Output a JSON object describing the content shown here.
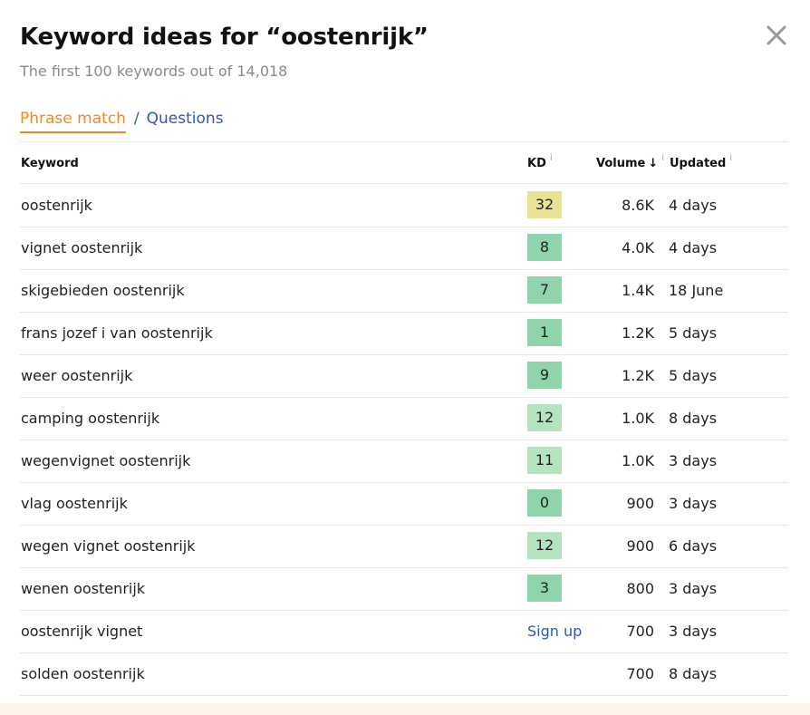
{
  "header": {
    "title": "Keyword ideas for “oostenrijk”",
    "subtitle": "The first 100 keywords out of 14,018"
  },
  "tabs": {
    "active": "Phrase match",
    "separator": "/",
    "other": "Questions"
  },
  "columns": {
    "keyword": "Keyword",
    "kd": "KD",
    "volume": "Volume",
    "updated": "Updated",
    "info_glyph": "i",
    "sort_arrow": "↓"
  },
  "rows": [
    {
      "keyword": "oostenrijk",
      "kd": "32",
      "kd_color": "#e8e391",
      "volume": "8.6K",
      "updated": "4 days"
    },
    {
      "keyword": "vignet oostenrijk",
      "kd": "8",
      "kd_color": "#8fd4ab",
      "volume": "4.0K",
      "updated": "4 days"
    },
    {
      "keyword": "skigebieden oostenrijk",
      "kd": "7",
      "kd_color": "#8fd4ab",
      "volume": "1.4K",
      "updated": "18 June"
    },
    {
      "keyword": "frans jozef i van oostenrijk",
      "kd": "1",
      "kd_color": "#8fd4ab",
      "volume": "1.2K",
      "updated": "5 days"
    },
    {
      "keyword": "weer oostenrijk",
      "kd": "9",
      "kd_color": "#8fd4ab",
      "volume": "1.2K",
      "updated": "5 days"
    },
    {
      "keyword": "camping oostenrijk",
      "kd": "12",
      "kd_color": "#b5e3c0",
      "volume": "1.0K",
      "updated": "8 days"
    },
    {
      "keyword": "wegenvignet oostenrijk",
      "kd": "11",
      "kd_color": "#b5e3c0",
      "volume": "1.0K",
      "updated": "3 days"
    },
    {
      "keyword": "vlag oostenrijk",
      "kd": "0",
      "kd_color": "#8fd4ab",
      "volume": "900",
      "updated": "3 days"
    },
    {
      "keyword": "wegen vignet oostenrijk",
      "kd": "12",
      "kd_color": "#b5e3c0",
      "volume": "900",
      "updated": "6 days"
    },
    {
      "keyword": "wenen oostenrijk",
      "kd": "3",
      "kd_color": "#8fd4ab",
      "volume": "800",
      "updated": "3 days"
    },
    {
      "keyword": "oostenrijk vignet",
      "kd": "",
      "kd_link": "Sign up",
      "volume": "700",
      "updated": "3 days"
    },
    {
      "keyword": "solden oostenrijk",
      "kd": "",
      "volume": "700",
      "updated": "8 days"
    }
  ],
  "icons": {
    "close": "close-icon"
  }
}
